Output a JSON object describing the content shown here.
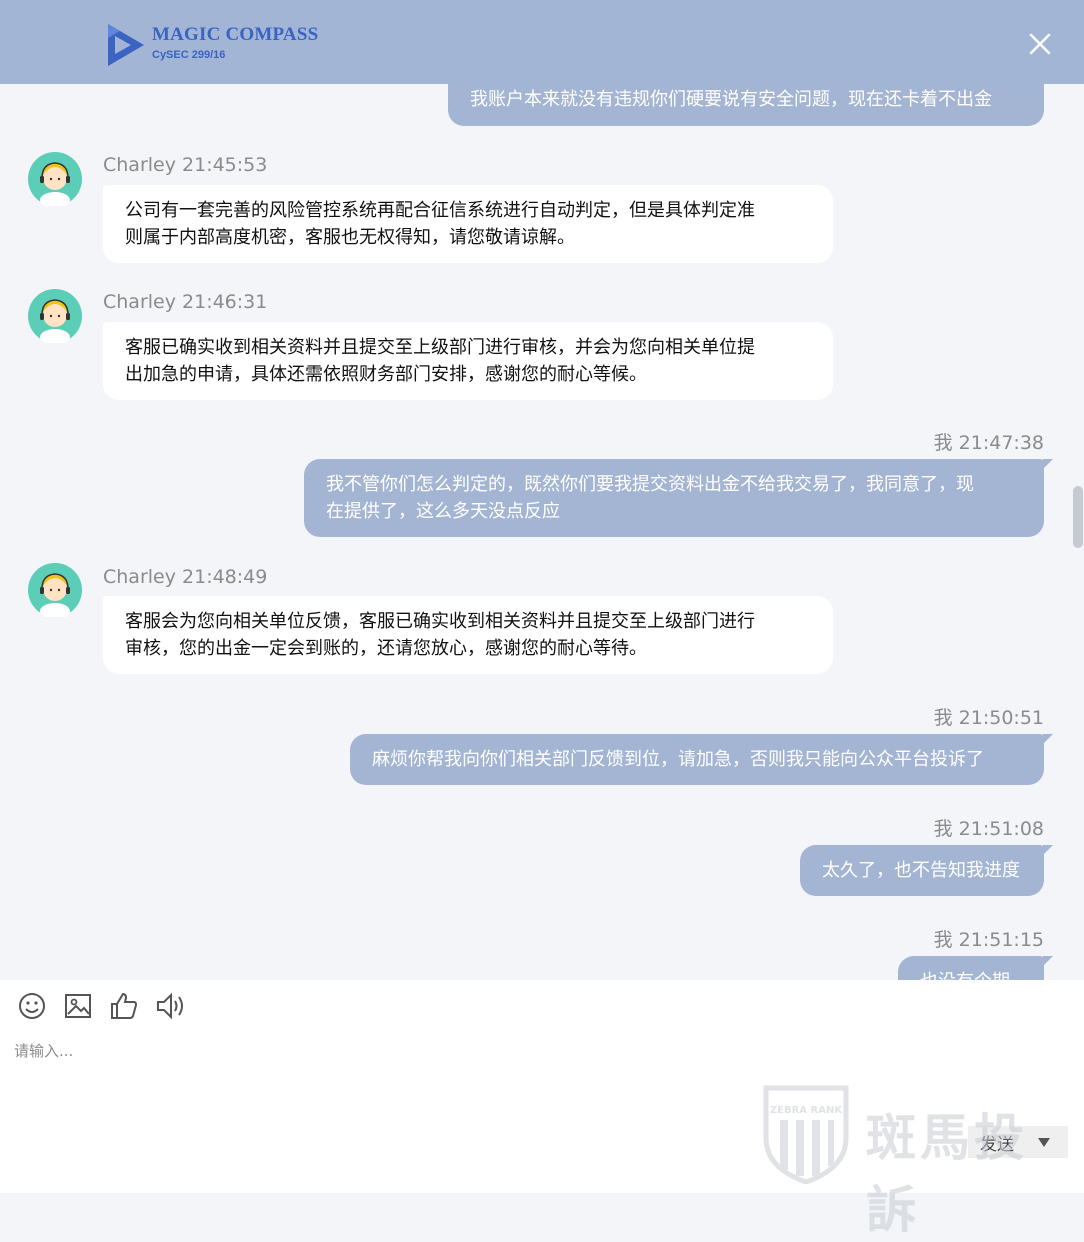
{
  "header": {
    "brand_name": "MAGIC COMPASS",
    "brand_sub": "CySEC 299/16",
    "close_icon": "close-icon",
    "colors": {
      "header_bg": "#a3b5d4",
      "brand": "#3a63c2"
    }
  },
  "messages": [
    {
      "from": "me",
      "text": "我账户本来就没有违规你们硬要说有安全问题，现在还卡着不出金"
    },
    {
      "from": "agent",
      "meta": "Charley 21:45:53",
      "lines": [
        "公司有一套完善的风险管控系统再配合征信系统进行自动判定，但是具体判定准",
        "则属于内部高度机密，客服也无权得知，请您敬请谅解。"
      ]
    },
    {
      "from": "agent",
      "meta": "Charley 21:46:31",
      "lines": [
        "客服已确实收到相关资料并且提交至上级部门进行审核，并会为您向相关单位提",
        "出加急的申请，具体还需依照财务部门安排，感谢您的耐心等候。"
      ]
    },
    {
      "from": "me",
      "meta": "我 21:47:38",
      "lines": [
        "我不管你们怎么判定的，既然你们要我提交资料出金不给我交易了，我同意了，现",
        "在提供了，这么多天没点反应"
      ]
    },
    {
      "from": "agent",
      "meta": "Charley 21:48:49",
      "lines": [
        "客服会为您向相关单位反馈，客服已确实收到相关资料并且提交至上级部门进行",
        "审核，您的出金一定会到账的，还请您放心，感谢您的耐心等待。"
      ]
    },
    {
      "from": "me",
      "meta": "我 21:50:51",
      "text": "麻烦你帮我向你们相关部门反馈到位，请加急，否则我只能向公众平台投诉了"
    },
    {
      "from": "me",
      "meta": "我 21:51:08",
      "text": "太久了，也不告知我进度"
    },
    {
      "from": "me",
      "meta": "我 21:51:15",
      "text": "也没有个期限"
    }
  ],
  "toolbar": {
    "icons": [
      "emoji-icon",
      "image-icon",
      "thumbs-up-icon",
      "speaker-icon"
    ],
    "input_placeholder": "请输入...",
    "send_label": "发送"
  },
  "watermark": {
    "text": "斑馬投訴",
    "badge_text": "ZEBRA RANK"
  }
}
